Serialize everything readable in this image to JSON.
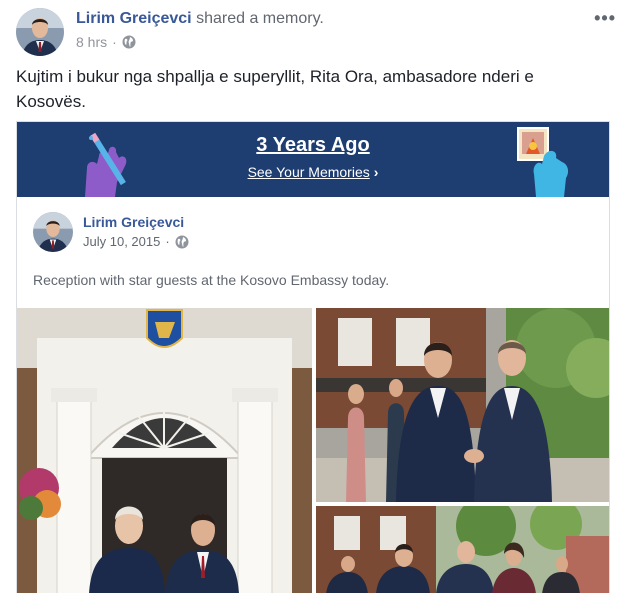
{
  "post": {
    "author": "Lirim Greiçevci",
    "action": "shared a memory.",
    "time": "8 hrs",
    "separator": "·",
    "privacy_icon": "globe-icon",
    "more_icon": "more-icon",
    "more_label": "•••",
    "text": "Kujtim i bukur nga shpallja e superyllit, Rita Ora, ambasadore nderi e Kosovës."
  },
  "memory": {
    "title": "3 Years Ago",
    "link_label": "See Your Memories",
    "link_chevron": "›",
    "banner_color": "#1e3d70"
  },
  "original_post": {
    "author": "Lirim Greiçevci",
    "date": "July 10, 2015",
    "separator": "·",
    "privacy_icon": "globe-icon",
    "text": "Reception with star guests at the Kosovo Embassy today."
  },
  "colors": {
    "link": "#385898",
    "meta": "#90949c"
  }
}
